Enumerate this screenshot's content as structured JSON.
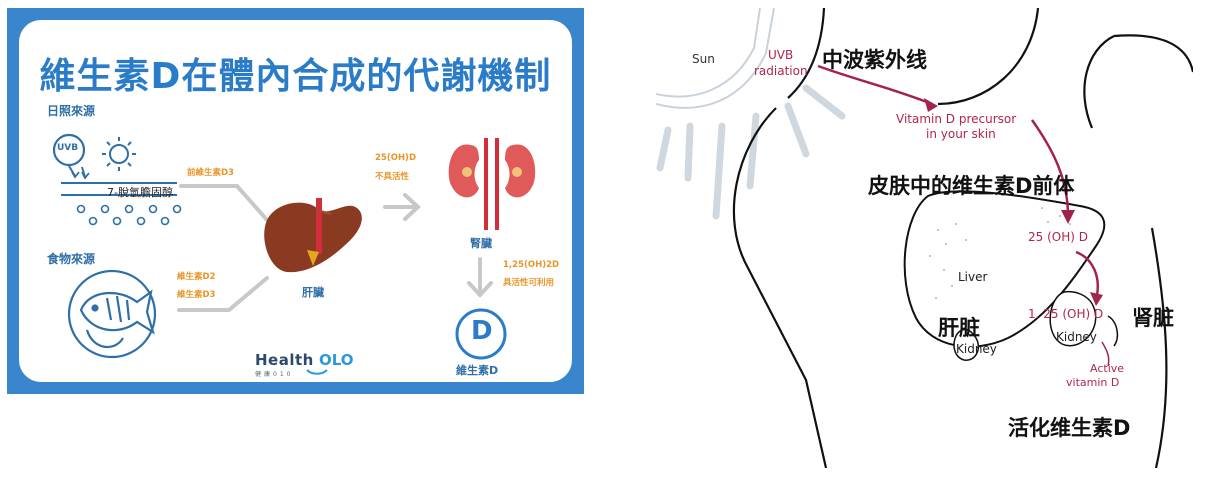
{
  "left": {
    "title": "維生素D在體內合成的代謝機制",
    "sunlight_source": "日照來源",
    "uvb": "UVB",
    "skin_compound": "7-脫氫膽固醇",
    "food_source": "食物來源",
    "pre_d3": "前維生素D3",
    "d2": "維生素D2",
    "d3": "維生素D3",
    "liver": "肝臟",
    "ohd_25": "25(OH)D",
    "inactive": "不具活性",
    "kidney": "腎臟",
    "ohd_125": "1,25(OH)2D",
    "usable": "具活性可利用",
    "d_letter": "D",
    "vitamin_d": "維生素D",
    "logo_text": "Health",
    "logo_num": "OLO",
    "logo_sub": "健康010",
    "colors": {
      "blue": "#3a86cc",
      "orange": "#e8962a",
      "liver": "#8b3a22",
      "kidney": "#e05a5a"
    }
  },
  "right": {
    "sun": "Sun",
    "uvb_radiation_1": "UVB",
    "uvb_radiation_2": "radiation",
    "cn_uvb": "中波紫外线",
    "precursor_1": "Vitamin D precursor",
    "precursor_2": "in your skin",
    "cn_precursor": "皮肤中的维生素D前体",
    "ohd_25": "25 (OH) D",
    "liver": "Liver",
    "cn_liver": "肝脏",
    "ohd_125": "1. 25 (OH) D",
    "cn_kidney": "肾脏",
    "kidney_1": "Kidney",
    "kidney_2": "Kidney",
    "active_1": "Active",
    "active_2": "vitamin D",
    "cn_active": "活化维生素D",
    "colors": {
      "arrow": "#a3244a",
      "sun_lines": "#c9d2da",
      "body_fill": "#dfe6ec"
    }
  }
}
